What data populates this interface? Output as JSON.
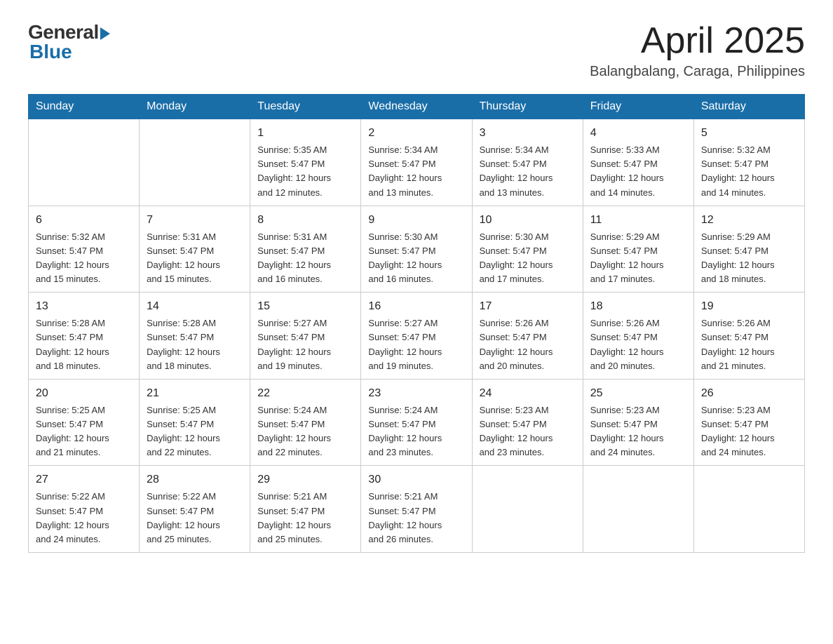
{
  "logo": {
    "general": "General",
    "blue": "Blue"
  },
  "title": {
    "month": "April 2025",
    "location": "Balangbalang, Caraga, Philippines"
  },
  "weekdays": [
    "Sunday",
    "Monday",
    "Tuesday",
    "Wednesday",
    "Thursday",
    "Friday",
    "Saturday"
  ],
  "weeks": [
    [
      {
        "day": "",
        "info": ""
      },
      {
        "day": "",
        "info": ""
      },
      {
        "day": "1",
        "info": "Sunrise: 5:35 AM\nSunset: 5:47 PM\nDaylight: 12 hours\nand 12 minutes."
      },
      {
        "day": "2",
        "info": "Sunrise: 5:34 AM\nSunset: 5:47 PM\nDaylight: 12 hours\nand 13 minutes."
      },
      {
        "day": "3",
        "info": "Sunrise: 5:34 AM\nSunset: 5:47 PM\nDaylight: 12 hours\nand 13 minutes."
      },
      {
        "day": "4",
        "info": "Sunrise: 5:33 AM\nSunset: 5:47 PM\nDaylight: 12 hours\nand 14 minutes."
      },
      {
        "day": "5",
        "info": "Sunrise: 5:32 AM\nSunset: 5:47 PM\nDaylight: 12 hours\nand 14 minutes."
      }
    ],
    [
      {
        "day": "6",
        "info": "Sunrise: 5:32 AM\nSunset: 5:47 PM\nDaylight: 12 hours\nand 15 minutes."
      },
      {
        "day": "7",
        "info": "Sunrise: 5:31 AM\nSunset: 5:47 PM\nDaylight: 12 hours\nand 15 minutes."
      },
      {
        "day": "8",
        "info": "Sunrise: 5:31 AM\nSunset: 5:47 PM\nDaylight: 12 hours\nand 16 minutes."
      },
      {
        "day": "9",
        "info": "Sunrise: 5:30 AM\nSunset: 5:47 PM\nDaylight: 12 hours\nand 16 minutes."
      },
      {
        "day": "10",
        "info": "Sunrise: 5:30 AM\nSunset: 5:47 PM\nDaylight: 12 hours\nand 17 minutes."
      },
      {
        "day": "11",
        "info": "Sunrise: 5:29 AM\nSunset: 5:47 PM\nDaylight: 12 hours\nand 17 minutes."
      },
      {
        "day": "12",
        "info": "Sunrise: 5:29 AM\nSunset: 5:47 PM\nDaylight: 12 hours\nand 18 minutes."
      }
    ],
    [
      {
        "day": "13",
        "info": "Sunrise: 5:28 AM\nSunset: 5:47 PM\nDaylight: 12 hours\nand 18 minutes."
      },
      {
        "day": "14",
        "info": "Sunrise: 5:28 AM\nSunset: 5:47 PM\nDaylight: 12 hours\nand 18 minutes."
      },
      {
        "day": "15",
        "info": "Sunrise: 5:27 AM\nSunset: 5:47 PM\nDaylight: 12 hours\nand 19 minutes."
      },
      {
        "day": "16",
        "info": "Sunrise: 5:27 AM\nSunset: 5:47 PM\nDaylight: 12 hours\nand 19 minutes."
      },
      {
        "day": "17",
        "info": "Sunrise: 5:26 AM\nSunset: 5:47 PM\nDaylight: 12 hours\nand 20 minutes."
      },
      {
        "day": "18",
        "info": "Sunrise: 5:26 AM\nSunset: 5:47 PM\nDaylight: 12 hours\nand 20 minutes."
      },
      {
        "day": "19",
        "info": "Sunrise: 5:26 AM\nSunset: 5:47 PM\nDaylight: 12 hours\nand 21 minutes."
      }
    ],
    [
      {
        "day": "20",
        "info": "Sunrise: 5:25 AM\nSunset: 5:47 PM\nDaylight: 12 hours\nand 21 minutes."
      },
      {
        "day": "21",
        "info": "Sunrise: 5:25 AM\nSunset: 5:47 PM\nDaylight: 12 hours\nand 22 minutes."
      },
      {
        "day": "22",
        "info": "Sunrise: 5:24 AM\nSunset: 5:47 PM\nDaylight: 12 hours\nand 22 minutes."
      },
      {
        "day": "23",
        "info": "Sunrise: 5:24 AM\nSunset: 5:47 PM\nDaylight: 12 hours\nand 23 minutes."
      },
      {
        "day": "24",
        "info": "Sunrise: 5:23 AM\nSunset: 5:47 PM\nDaylight: 12 hours\nand 23 minutes."
      },
      {
        "day": "25",
        "info": "Sunrise: 5:23 AM\nSunset: 5:47 PM\nDaylight: 12 hours\nand 24 minutes."
      },
      {
        "day": "26",
        "info": "Sunrise: 5:23 AM\nSunset: 5:47 PM\nDaylight: 12 hours\nand 24 minutes."
      }
    ],
    [
      {
        "day": "27",
        "info": "Sunrise: 5:22 AM\nSunset: 5:47 PM\nDaylight: 12 hours\nand 24 minutes."
      },
      {
        "day": "28",
        "info": "Sunrise: 5:22 AM\nSunset: 5:47 PM\nDaylight: 12 hours\nand 25 minutes."
      },
      {
        "day": "29",
        "info": "Sunrise: 5:21 AM\nSunset: 5:47 PM\nDaylight: 12 hours\nand 25 minutes."
      },
      {
        "day": "30",
        "info": "Sunrise: 5:21 AM\nSunset: 5:47 PM\nDaylight: 12 hours\nand 26 minutes."
      },
      {
        "day": "",
        "info": ""
      },
      {
        "day": "",
        "info": ""
      },
      {
        "day": "",
        "info": ""
      }
    ]
  ]
}
